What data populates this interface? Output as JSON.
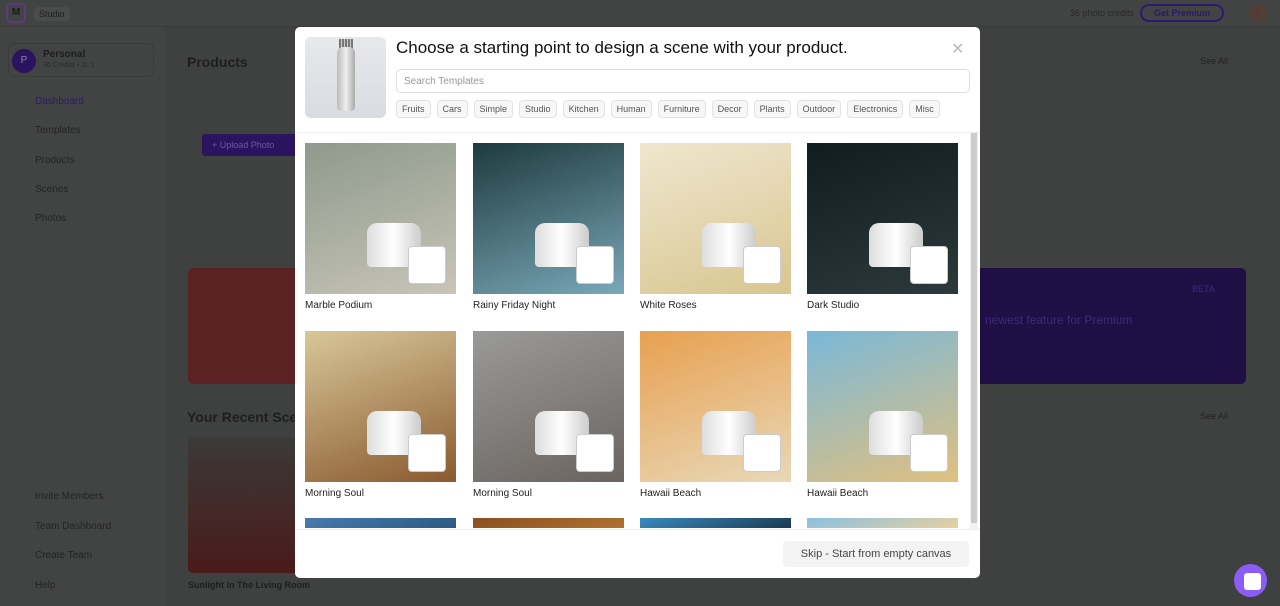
{
  "background": {
    "studio_label": "Studio",
    "credits": "36 photo credits",
    "get_premium": "Get Premium",
    "avatar_initial": "A",
    "workspace": {
      "initial": "P",
      "name": "Personal",
      "sub": "36 Credits • 2L 1"
    },
    "nav": [
      "Dashboard",
      "Templates",
      "Products",
      "Scenes",
      "Photos"
    ],
    "nav_bottom": [
      "Invite Members",
      "Team Dashboard",
      "Create Team",
      "Help"
    ],
    "products_title": "Products",
    "upload": "+ Upload Photo",
    "see_all": "See All",
    "recent_title": "Your Recent Scenes",
    "recent_item": "Sunlight In The Living Room",
    "beta": "BETA",
    "promo": "newest feature for Premium"
  },
  "modal": {
    "title": "Choose a starting point to design a scene with your product.",
    "search_placeholder": "Search Templates",
    "tags": [
      "Fruits",
      "Cars",
      "Simple",
      "Studio",
      "Kitchen",
      "Human",
      "Furniture",
      "Decor",
      "Plants",
      "Outdoor",
      "Electronics",
      "Misc"
    ],
    "templates": [
      {
        "name": "Marble Podium",
        "colors": [
          "#8e9a8c",
          "#c8c4b8"
        ]
      },
      {
        "name": "Rainy Friday Night",
        "colors": [
          "#1e3a3e",
          "#7aa8b8"
        ]
      },
      {
        "name": "White Roses",
        "colors": [
          "#efe6cf",
          "#d8c690"
        ]
      },
      {
        "name": "Dark Studio",
        "colors": [
          "#0f1d20",
          "#2c3a3c"
        ]
      },
      {
        "name": "Morning Soul",
        "colors": [
          "#d8c79a",
          "#8a5a30"
        ]
      },
      {
        "name": "Morning Soul",
        "colors": [
          "#9a9a98",
          "#6a6460"
        ]
      },
      {
        "name": "Hawaii Beach",
        "colors": [
          "#e8a050",
          "#e8d8b8"
        ]
      },
      {
        "name": "Hawaii Beach",
        "colors": [
          "#7ab8d8",
          "#e0c080"
        ]
      },
      {
        "name": "",
        "colors": [
          "#4a7ab0",
          "#2a5a80"
        ]
      },
      {
        "name": "",
        "colors": [
          "#8a5020",
          "#b07030"
        ]
      },
      {
        "name": "",
        "colors": [
          "#3a8ac0",
          "#1a3a50"
        ]
      },
      {
        "name": "",
        "colors": [
          "#8ac0e0",
          "#e8d0a0"
        ]
      }
    ],
    "skip_label": "Skip - Start from empty canvas"
  }
}
